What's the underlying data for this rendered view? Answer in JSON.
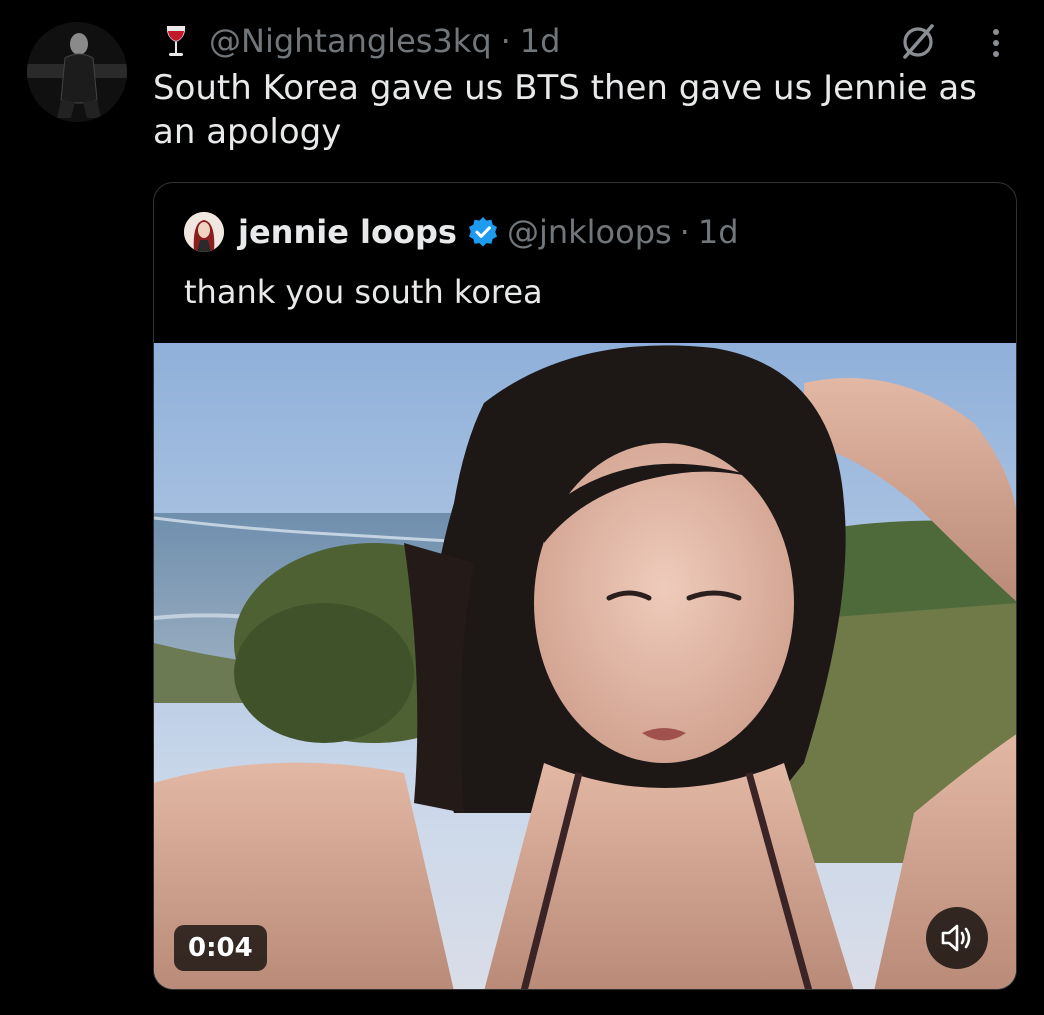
{
  "tweet": {
    "handle": "@Nightangles3kq",
    "separator": "·",
    "time": "1d",
    "text": "South Korea gave us BTS then gave us Jennie as an apology",
    "icons": {
      "badge": "wine-glass-icon",
      "grok": "grok-icon",
      "more": "more-vertical-icon"
    }
  },
  "quote": {
    "name": "jennie loops",
    "verified_icon": "verified-badge-icon",
    "handle": "@jnkloops",
    "separator": "·",
    "time": "1d",
    "text": "thank you south korea",
    "video": {
      "duration": "0:04",
      "volume_icon": "volume-icon"
    }
  },
  "colors": {
    "background": "#000000",
    "text_primary": "#e7e9ea",
    "text_secondary": "#71767b",
    "border": "#2f3336",
    "verified": "#1d9bf0"
  }
}
